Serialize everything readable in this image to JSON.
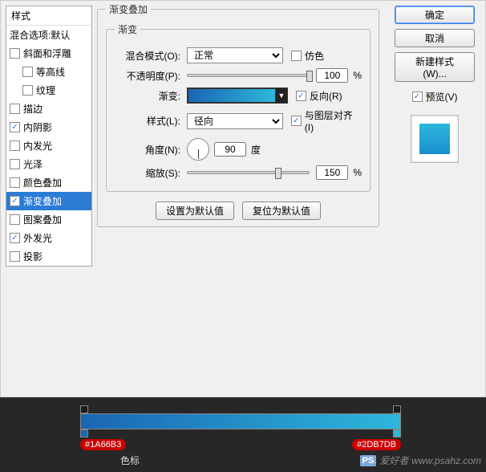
{
  "sidebar": {
    "header": "样式",
    "blending": "混合选项:默认",
    "items": [
      {
        "label": "斜面和浮雕",
        "checked": false
      },
      {
        "label": "等高线",
        "checked": false,
        "indent": true
      },
      {
        "label": "纹理",
        "checked": false,
        "indent": true
      },
      {
        "label": "描边",
        "checked": false
      },
      {
        "label": "内阴影",
        "checked": true
      },
      {
        "label": "内发光",
        "checked": false
      },
      {
        "label": "光泽",
        "checked": false
      },
      {
        "label": "颜色叠加",
        "checked": false
      },
      {
        "label": "渐变叠加",
        "checked": true,
        "selected": true
      },
      {
        "label": "图案叠加",
        "checked": false
      },
      {
        "label": "外发光",
        "checked": true
      },
      {
        "label": "投影",
        "checked": false
      }
    ]
  },
  "panel": {
    "groupTitle": "渐变叠加",
    "subTitle": "渐变",
    "blendModeLabel": "混合模式(O):",
    "blendModeValue": "正常",
    "ditherLabel": "仿色",
    "opacityLabel": "不透明度(P):",
    "opacityValue": "100",
    "opacityUnit": "%",
    "gradientLabel": "渐变:",
    "reverseLabel": "反向(R)",
    "styleLabel": "样式(L):",
    "styleValue": "径向",
    "alignLabel": "与图层对齐(I)",
    "angleLabel": "角度(N):",
    "angleValue": "90",
    "angleUnit": "度",
    "scaleLabel": "缩放(S):",
    "scaleValue": "150",
    "scaleUnit": "%",
    "setDefault": "设置为默认值",
    "resetDefault": "复位为默认值"
  },
  "right": {
    "ok": "确定",
    "cancel": "取消",
    "newStyle": "新建样式(W)...",
    "previewLabel": "预览(V)"
  },
  "gradient": {
    "stops": [
      {
        "hex": "#1A66B3",
        "pos": 0
      },
      {
        "hex": "#2DB7DB",
        "pos": 100
      }
    ],
    "sectionLabel": "色标"
  },
  "watermark": {
    "brand": "PS",
    "text1": "爱好者",
    "text2": "www.psahz.com"
  }
}
